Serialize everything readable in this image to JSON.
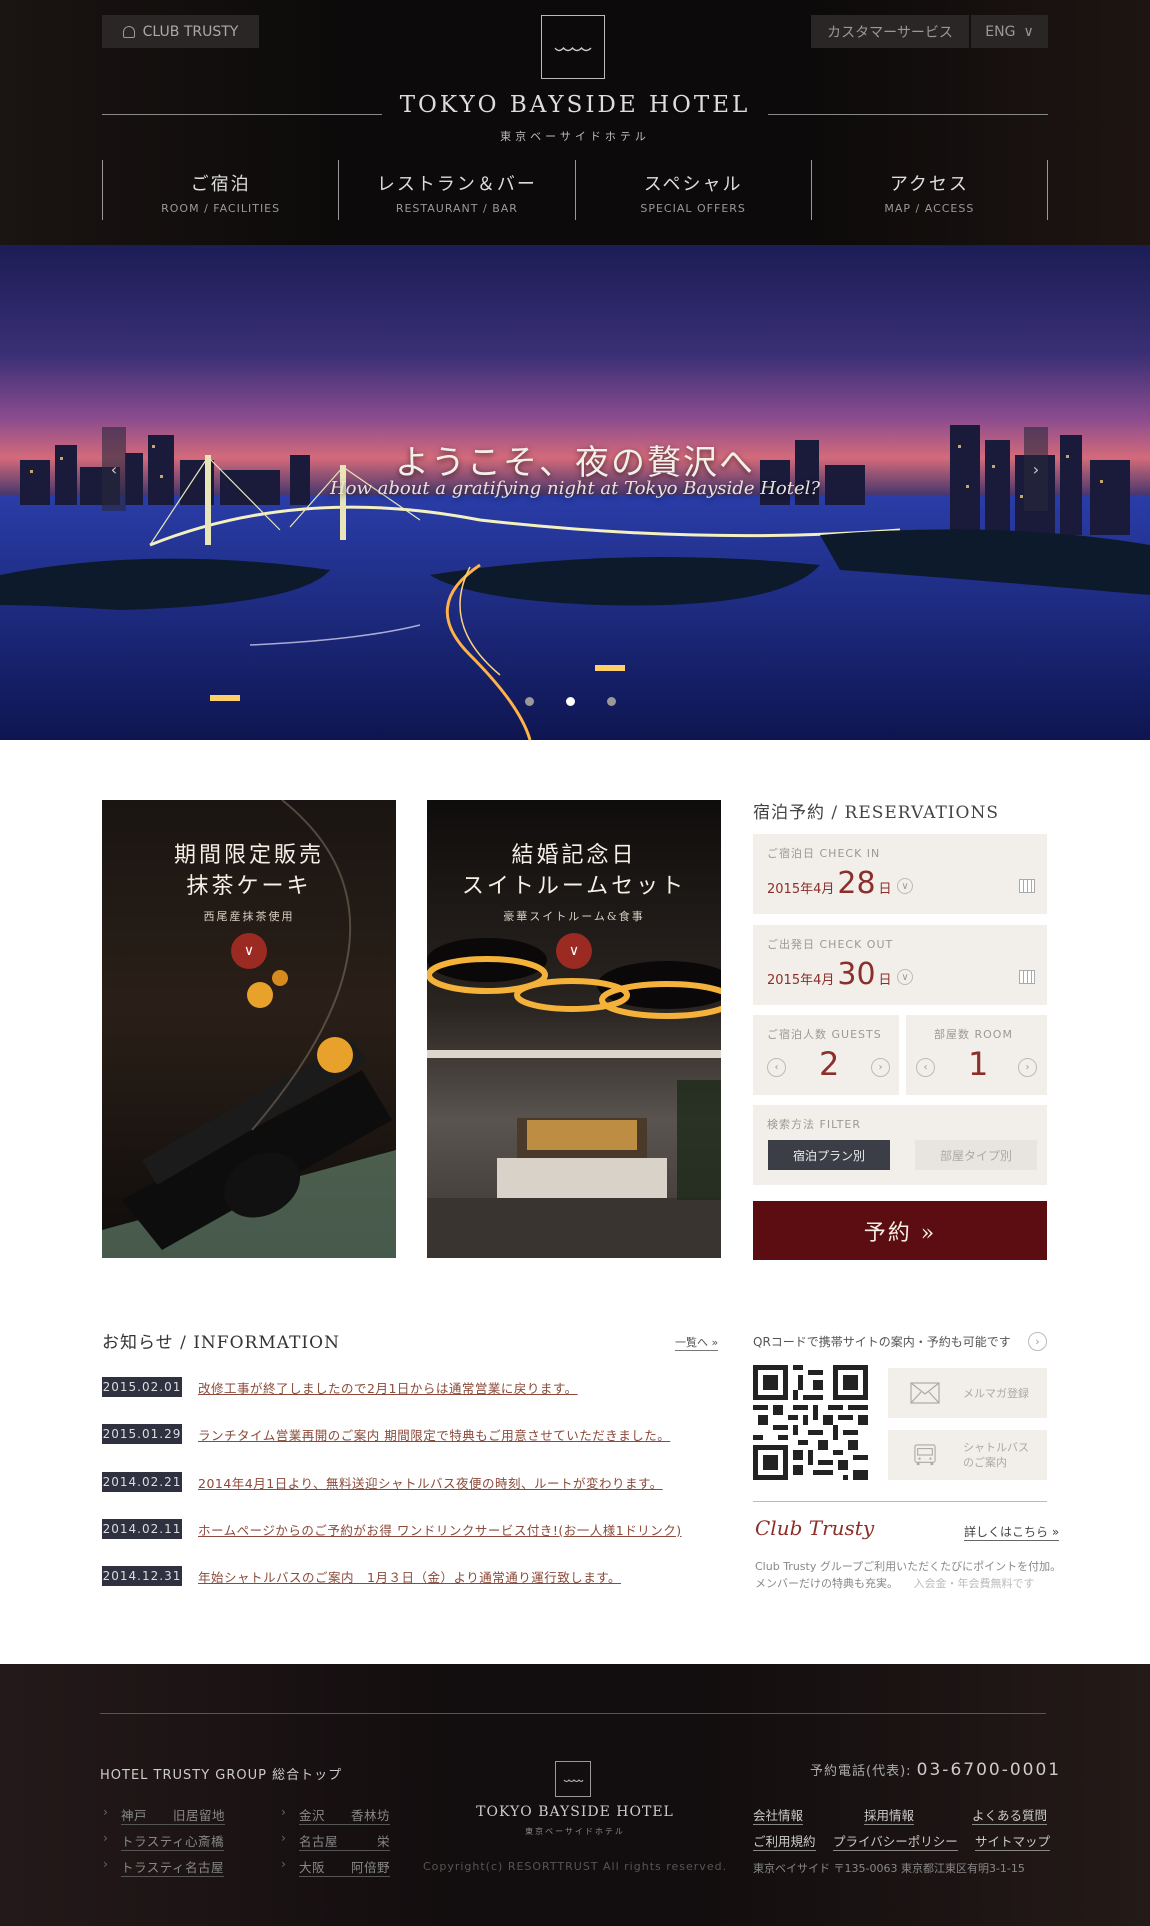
{
  "header": {
    "club_button": "CLUB TRUSTY",
    "customer_service": "カスタマーサービス",
    "language": "ENG",
    "hotel_name": "TOKYO BAYSIDE HOTEL",
    "hotel_name_jp": "東京ベーサイドホテル",
    "nav": [
      {
        "jp": "ご宿泊",
        "en": "ROOM / FACILITIES"
      },
      {
        "jp": "レストラン＆バー",
        "en": "RESTAURANT / BAR"
      },
      {
        "jp": "スペシャル",
        "en": "SPECIAL OFFERS"
      },
      {
        "jp": "アクセス",
        "en": "MAP / ACCESS"
      }
    ]
  },
  "hero": {
    "title": "ようこそ、夜の贅沢へ",
    "subtitle": "How about a gratifying night at Tokyo Bayside Hotel?",
    "prev": "‹",
    "next": "›",
    "slide_count": 3,
    "active_slide": 2
  },
  "promos": [
    {
      "title_line1": "期間限定販売",
      "title_line2": "抹茶ケーキ",
      "sub": "西尾産抹茶使用",
      "arrow": "∨"
    },
    {
      "title_line1": "結婚記念日",
      "title_line2": "スイトルームセット",
      "sub": "豪華スイトルーム&食事",
      "arrow": "∨"
    }
  ],
  "reservation": {
    "heading": "宿泊予約 / RESERVATIONS",
    "checkin": {
      "label": "ご宿泊日 CHECK IN",
      "year_month": "2015年4月",
      "day": "28",
      "day_suffix": "日"
    },
    "checkout": {
      "label": "ご出発日 CHECK OUT",
      "year_month": "2015年4月",
      "day": "30",
      "day_suffix": "日"
    },
    "guests": {
      "label": "ご宿泊人数 GUESTS",
      "value": "2"
    },
    "rooms": {
      "label": "部屋数 ROOM",
      "value": "1"
    },
    "filter": {
      "label": "検索方法 FILTER",
      "option_active": "宿泊プラン別",
      "option_inactive": "部屋タイプ別"
    },
    "submit": "予約 »"
  },
  "information": {
    "heading": "お知らせ / INFORMATION",
    "more": "一覧へ »",
    "items": [
      {
        "date": "2015.02.01",
        "text": "改修工事が終了しましたので2月1日からは通常営業に戻ります。"
      },
      {
        "date": "2015.01.29",
        "text": "ランチタイム営業再開のご案内 期間限定で特典もご用意させていただきました。"
      },
      {
        "date": "2014.02.21",
        "text": "2014年4月1日より、無料送迎シャトルバス夜便の時刻、ルートが変わります。"
      },
      {
        "date": "2014.02.11",
        "text": "ホームページからのご予約がお得 ワンドリンクサービス付き!(お一人様1ドリンク)"
      },
      {
        "date": "2014.12.31",
        "text": "年始シャトルバスのご案内　1月３日（金）より通常通り運行致します。"
      }
    ]
  },
  "side": {
    "qr_text": "QRコードで携帯サイトの案内・予約も可能です",
    "mail_button": "メルマガ登録",
    "shuttle_line1": "シャトルバス",
    "shuttle_line2": "のご案内",
    "club_title": "Club Trusty",
    "club_link": "詳しくはこちら »",
    "club_desc1": "Club Trusty グループご利用いただくたびにポイントを付加。",
    "club_desc2": "メンバーだけの特典も充実。",
    "club_desc3": "入会金・年会費無料です"
  },
  "footer": {
    "group": "HOTEL TRUSTY GROUP 総合トップ",
    "links_col1": [
      "神戸　　旧居留地",
      "トラスティ心斎橋",
      "トラスティ名古屋"
    ],
    "links_col2": [
      "金沢　　香林坊",
      "名古屋　　　栄",
      "大阪　　阿倍野"
    ],
    "hotel_name": "TOKYO BAYSIDE HOTEL",
    "hotel_name_jp": "東京ベーサイドホテル",
    "copyright": "Copyright(c) RESORTTRUST All rights reserved.",
    "phone_label": "予約電話(代表):",
    "phone": "03-6700-0001",
    "links_right": [
      [
        "会社情報",
        "採用情報",
        "よくある質問"
      ],
      [
        "ご利用規約",
        "プライバシーポリシー",
        "サイトマップ"
      ]
    ],
    "address": "東京ベイサイド 〒135-0063 東京都江東区有明3-1-15"
  },
  "colors": {
    "accent": "#8b2f2a",
    "reserve_button": "#5b0d12",
    "date_badge": "#2f3140",
    "header_bg": "#0c0a0a"
  }
}
